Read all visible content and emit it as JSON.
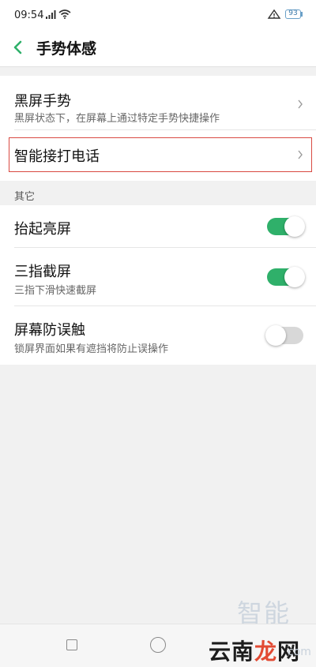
{
  "status_bar": {
    "time": "09:54",
    "battery": "93",
    "signal_icon": "signal-icon",
    "wifi_icon": "wifi-icon",
    "vpn_icon": "vpn-icon"
  },
  "header": {
    "back_icon": "chevron-left-icon",
    "title": "手势体感"
  },
  "gesture_group": {
    "items": [
      {
        "title": "黑屏手势",
        "subtitle": "黑屏状态下，在屏幕上通过特定手势快捷操作"
      },
      {
        "title": "智能接打电话",
        "highlighted": true
      }
    ]
  },
  "other_section": {
    "label": "其它",
    "items": [
      {
        "title": "抬起亮屏",
        "toggle": true
      },
      {
        "title": "三指截屏",
        "subtitle": "三指下滑快速截屏",
        "toggle": true
      },
      {
        "title": "屏幕防误触",
        "subtitle": "锁屏界面如果有遮挡将防止误操作",
        "toggle": false
      }
    ]
  },
  "colors": {
    "accent_green": "#2fb06a",
    "highlight_red": "#d94a42",
    "toggle_off": "#d8d8d8"
  },
  "watermark": {
    "top": "智能家",
    "main_prefix": "云南",
    "main_accent": "龙",
    "main_suffix": "网",
    "domain": "com"
  }
}
